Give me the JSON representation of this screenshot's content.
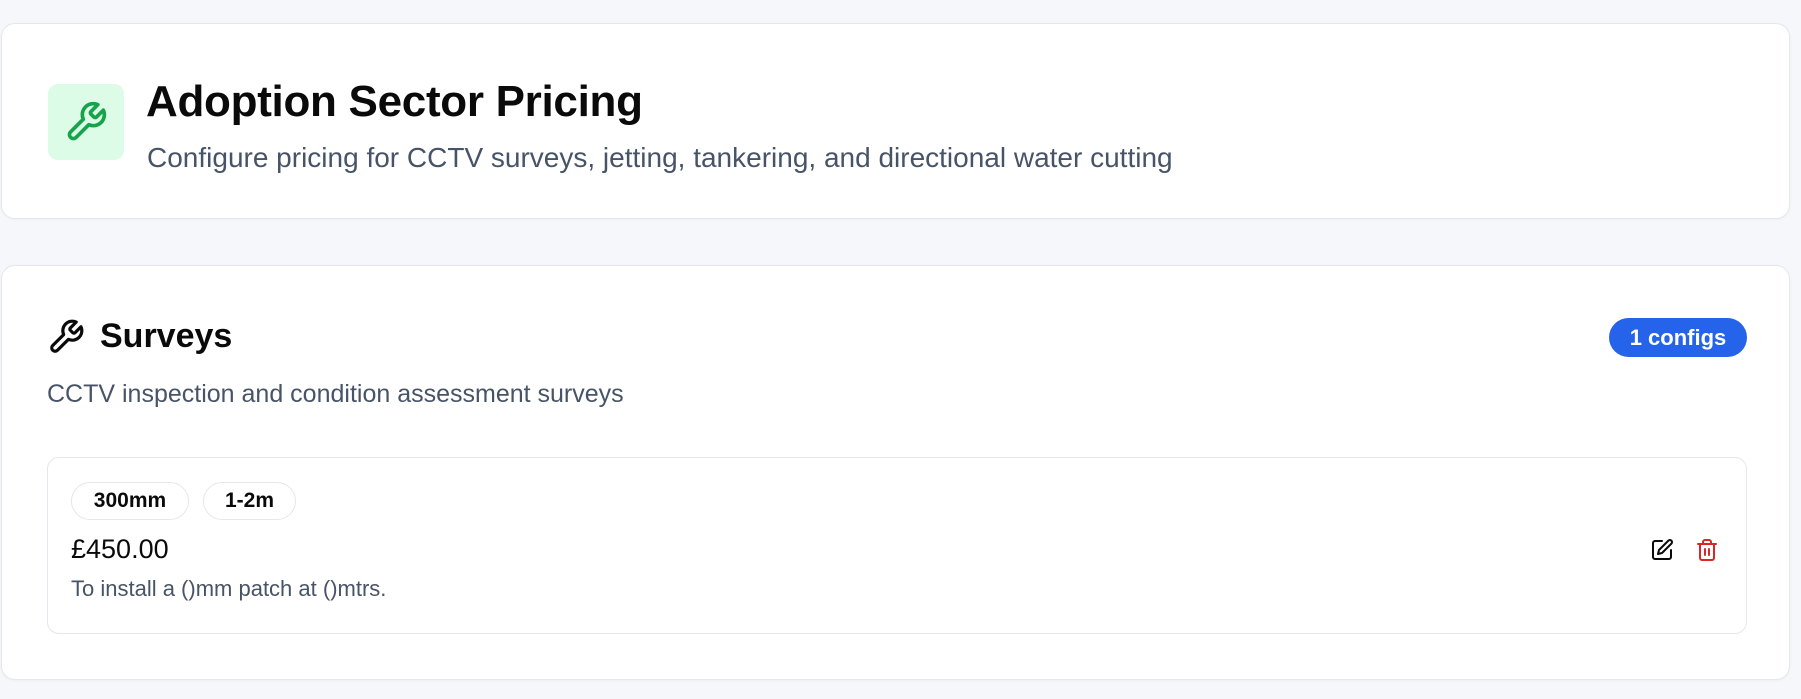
{
  "header": {
    "icon": "wrench-icon",
    "title": "Adoption Sector Pricing",
    "subtitle": "Configure pricing for CCTV surveys, jetting, tankering, and directional water cutting"
  },
  "section": {
    "icon": "wrench-icon",
    "title": "Surveys",
    "badge": "1 configs",
    "description": "CCTV inspection and condition assessment surveys",
    "configs": [
      {
        "tags": [
          "300mm",
          "1-2m"
        ],
        "price": "£450.00",
        "note": "To install a ()mm patch at ()mtrs.",
        "actions": [
          "edit-icon",
          "trash-icon"
        ]
      }
    ]
  },
  "colors": {
    "accent_green": "#16a34a",
    "icon_tile_bg": "#dcfce7",
    "badge_blue": "#2563eb",
    "danger_red": "#dc2626",
    "muted_text": "#475467",
    "page_bg": "#f5f7fa"
  }
}
